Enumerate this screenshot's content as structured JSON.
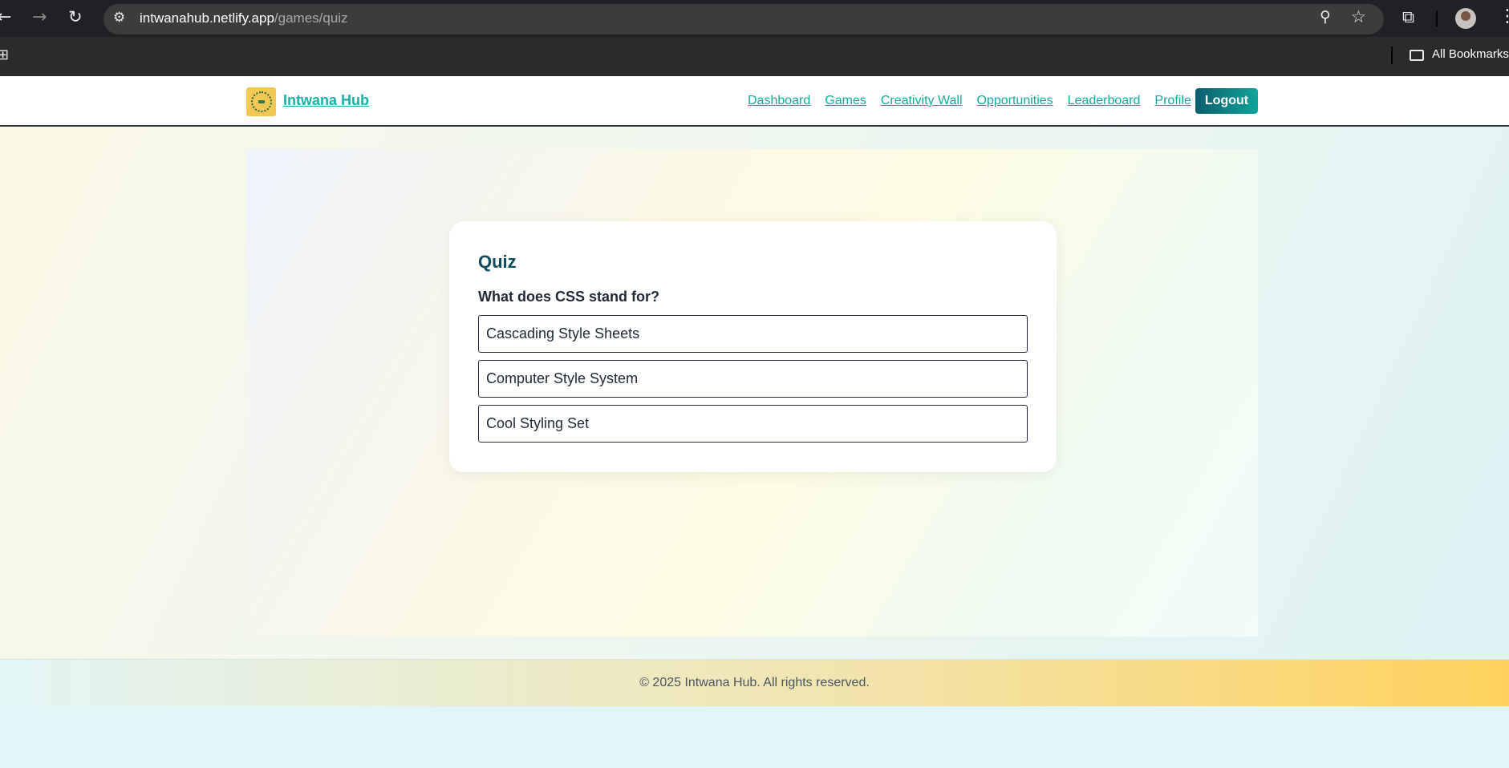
{
  "browser": {
    "url_host": "intwanahub.netlify.app",
    "url_path": "/games/quiz",
    "bookmarks_label": "All Bookmarks",
    "icons": [
      "back-arrow-icon",
      "forward-arrow-icon",
      "reload-icon",
      "site-settings-icon",
      "zoom-icon",
      "star-icon",
      "extensions-icon",
      "more-icon",
      "apps-grid-icon",
      "folder-icon"
    ]
  },
  "navbar": {
    "brand": "Intwana Hub",
    "links": [
      "Dashboard",
      "Games",
      "Creativity Wall",
      "Opportunities",
      "Leaderboard",
      "Profile"
    ],
    "logout": "Logout"
  },
  "quiz": {
    "title": "Quiz",
    "question": "What does CSS stand for?",
    "options": [
      "Cascading Style Sheets",
      "Computer Style System",
      "Cool Styling Set"
    ]
  },
  "footer": {
    "text": "© 2025 Intwana Hub. All rights reserved."
  },
  "colors": {
    "accent": "#12a99c",
    "heading": "#0d4c5c",
    "logout_start": "#0d5d6e",
    "logout_end": "#0fa59a",
    "footer_end": "#ffd15c"
  }
}
